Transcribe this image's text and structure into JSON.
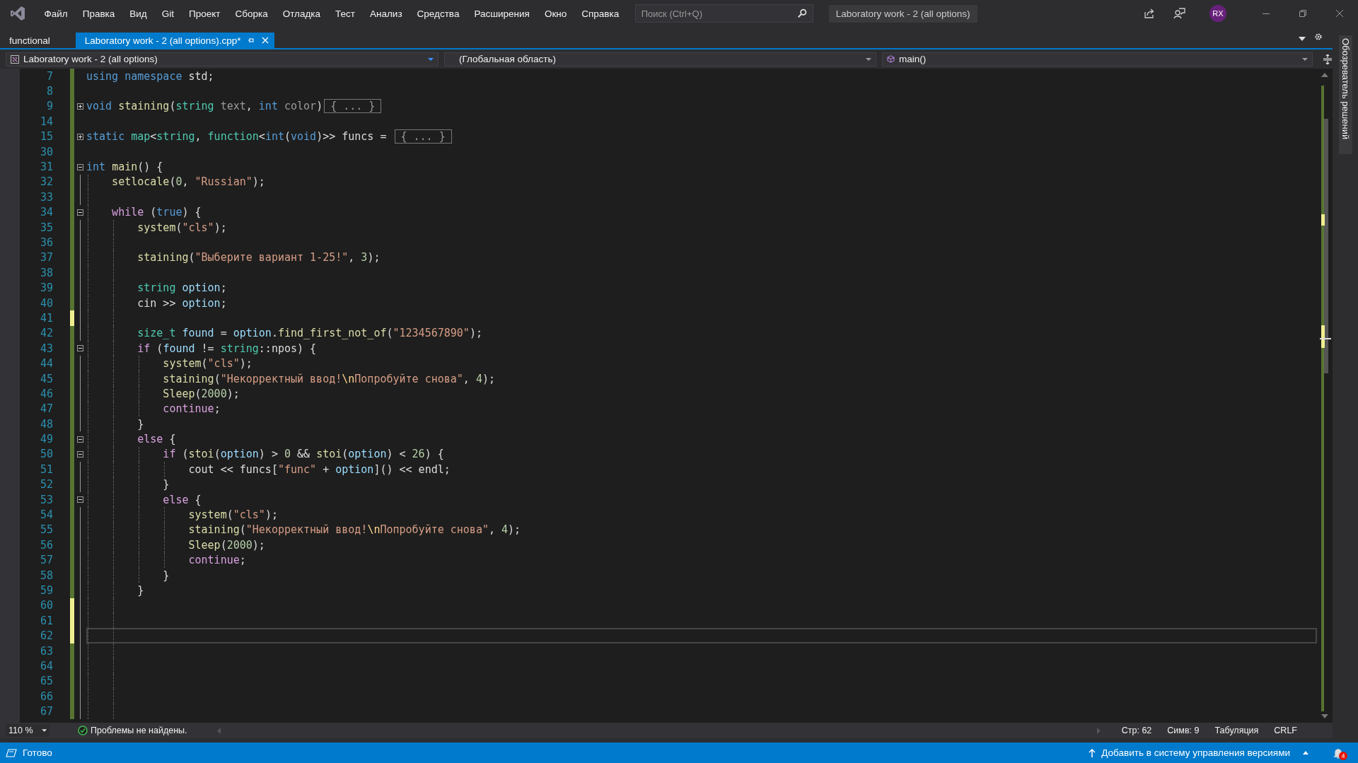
{
  "menu_bar": {
    "items": [
      "Файл",
      "Правка",
      "Вид",
      "Git",
      "Проект",
      "Сборка",
      "Отладка",
      "Тест",
      "Анализ",
      "Средства",
      "Расширения",
      "Окно",
      "Справка"
    ],
    "search": {
      "placeholder": "Поиск (Ctrl+Q)"
    },
    "window_title": "Laboratory work - 2 (all options)",
    "avatar": "RX"
  },
  "tabs": [
    {
      "label": "functional",
      "selected": false
    },
    {
      "label": "Laboratory work - 2 (all options).cpp*",
      "selected": true
    }
  ],
  "navigation_bar": {
    "project": "Laboratory work - 2 (all options)",
    "scope": "(Глобальная область)",
    "member": "main()"
  },
  "editor": {
    "lines": [
      {
        "number": "7",
        "unsaved": false,
        "current": false,
        "tokens": [
          {
            "kind": "keyword",
            "text": "using "
          },
          {
            "kind": "keyword",
            "text": "namespace "
          },
          {
            "kind": "plain",
            "text": "std;"
          }
        ]
      },
      {
        "number": "8",
        "unsaved": false,
        "current": false
      },
      {
        "number": "9",
        "unsaved": false,
        "current": false,
        "collapsed": true,
        "tokens": [
          {
            "kind": "keyword",
            "text": "void "
          },
          {
            "kind": "function",
            "text": "staining"
          },
          {
            "kind": "plain",
            "text": "("
          },
          {
            "kind": "type",
            "text": "string "
          },
          {
            "kind": "parameter",
            "text": "text"
          },
          {
            "kind": "plain",
            "text": ", "
          },
          {
            "kind": "keyword",
            "text": "int "
          },
          {
            "kind": "parameter",
            "text": "color"
          },
          {
            "kind": "plain",
            "text": ")"
          },
          {
            "kind": "collapsed",
            "text": "{ ... }"
          }
        ]
      },
      {
        "number": "14",
        "unsaved": false,
        "current": false
      },
      {
        "number": "15",
        "unsaved": false,
        "current": false,
        "collapsed": true,
        "tokens": [
          {
            "kind": "keyword",
            "text": "static "
          },
          {
            "kind": "type",
            "text": "map"
          },
          {
            "kind": "plain",
            "text": "<"
          },
          {
            "kind": "type",
            "text": "string"
          },
          {
            "kind": "plain",
            "text": ", "
          },
          {
            "kind": "type",
            "text": "function"
          },
          {
            "kind": "plain",
            "text": "<"
          },
          {
            "kind": "keyword",
            "text": "int"
          },
          {
            "kind": "plain",
            "text": "("
          },
          {
            "kind": "keyword",
            "text": "void"
          },
          {
            "kind": "plain",
            "text": ")>> funcs = "
          },
          {
            "kind": "collapsed",
            "text": "{ ... }"
          }
        ]
      },
      {
        "number": "30",
        "unsaved": false,
        "current": false
      },
      {
        "number": "31",
        "unsaved": false,
        "current": false,
        "collapsed": false,
        "tokens": [
          {
            "kind": "keyword",
            "text": "int "
          },
          {
            "kind": "function",
            "text": "main"
          },
          {
            "kind": "plain",
            "text": "() {"
          }
        ]
      },
      {
        "number": "32",
        "unsaved": false,
        "current": false,
        "tokens": [
          {
            "kind": "function",
            "text": "    setlocale"
          },
          {
            "kind": "plain",
            "text": "("
          },
          {
            "kind": "number",
            "text": "0"
          },
          {
            "kind": "plain",
            "text": ", "
          },
          {
            "kind": "string",
            "text": "\"Russian\""
          },
          {
            "kind": "plain",
            "text": ");"
          }
        ]
      },
      {
        "number": "33",
        "unsaved": false,
        "current": false
      },
      {
        "number": "34",
        "unsaved": false,
        "current": false,
        "collapsed": false,
        "tokens": [
          {
            "kind": "control",
            "text": "    while "
          },
          {
            "kind": "plain",
            "text": "("
          },
          {
            "kind": "keyword",
            "text": "true"
          },
          {
            "kind": "plain",
            "text": ") {"
          }
        ]
      },
      {
        "number": "35",
        "unsaved": false,
        "current": false,
        "tokens": [
          {
            "kind": "function",
            "text": "        system"
          },
          {
            "kind": "plain",
            "text": "("
          },
          {
            "kind": "string",
            "text": "\"cls\""
          },
          {
            "kind": "plain",
            "text": ");"
          }
        ]
      },
      {
        "number": "36",
        "unsaved": false,
        "current": false
      },
      {
        "number": "37",
        "unsaved": false,
        "current": false,
        "tokens": [
          {
            "kind": "function",
            "text": "        staining"
          },
          {
            "kind": "plain",
            "text": "("
          },
          {
            "kind": "string",
            "text": "\"Выберите вариант 1-25!\""
          },
          {
            "kind": "plain",
            "text": ", "
          },
          {
            "kind": "number",
            "text": "3"
          },
          {
            "kind": "plain",
            "text": ");"
          }
        ]
      },
      {
        "number": "38",
        "unsaved": false,
        "current": false
      },
      {
        "number": "39",
        "unsaved": false,
        "current": false,
        "tokens": [
          {
            "kind": "type",
            "text": "        string "
          },
          {
            "kind": "variable",
            "text": "option"
          },
          {
            "kind": "plain",
            "text": ";"
          }
        ]
      },
      {
        "number": "40",
        "unsaved": false,
        "current": false,
        "tokens": [
          {
            "kind": "plain",
            "text": "        cin >> "
          },
          {
            "kind": "variable",
            "text": "option"
          },
          {
            "kind": "plain",
            "text": ";"
          }
        ]
      },
      {
        "number": "41",
        "unsaved": true,
        "current": false
      },
      {
        "number": "42",
        "unsaved": false,
        "current": false,
        "tokens": [
          {
            "kind": "type",
            "text": "        size_t "
          },
          {
            "kind": "variable",
            "text": "found"
          },
          {
            "kind": "plain",
            "text": " = "
          },
          {
            "kind": "variable",
            "text": "option"
          },
          {
            "kind": "plain",
            "text": "."
          },
          {
            "kind": "function",
            "text": "find_first_not_of"
          },
          {
            "kind": "plain",
            "text": "("
          },
          {
            "kind": "string",
            "text": "\"1234567890\""
          },
          {
            "kind": "plain",
            "text": ");"
          }
        ]
      },
      {
        "number": "43",
        "unsaved": false,
        "current": false,
        "collapsed": false,
        "tokens": [
          {
            "kind": "control",
            "text": "        if "
          },
          {
            "kind": "plain",
            "text": "("
          },
          {
            "kind": "variable",
            "text": "found"
          },
          {
            "kind": "plain",
            "text": " != "
          },
          {
            "kind": "type",
            "text": "string"
          },
          {
            "kind": "plain",
            "text": "::npos) {"
          }
        ]
      },
      {
        "number": "44",
        "unsaved": false,
        "current": false,
        "tokens": [
          {
            "kind": "function",
            "text": "            system"
          },
          {
            "kind": "plain",
            "text": "("
          },
          {
            "kind": "string",
            "text": "\"cls\""
          },
          {
            "kind": "plain",
            "text": ");"
          }
        ]
      },
      {
        "number": "45",
        "unsaved": false,
        "current": false,
        "tokens": [
          {
            "kind": "function",
            "text": "            staining"
          },
          {
            "kind": "plain",
            "text": "("
          },
          {
            "kind": "string",
            "text": "\"Некорректный ввод!"
          },
          {
            "kind": "escape",
            "text": "\\n"
          },
          {
            "kind": "string",
            "text": "Попробуйте снова\""
          },
          {
            "kind": "plain",
            "text": ", "
          },
          {
            "kind": "number",
            "text": "4"
          },
          {
            "kind": "plain",
            "text": ");"
          }
        ]
      },
      {
        "number": "46",
        "unsaved": false,
        "current": false,
        "tokens": [
          {
            "kind": "function",
            "text": "            Sleep"
          },
          {
            "kind": "plain",
            "text": "("
          },
          {
            "kind": "number",
            "text": "2000"
          },
          {
            "kind": "plain",
            "text": ");"
          }
        ]
      },
      {
        "number": "47",
        "unsaved": false,
        "current": false,
        "tokens": [
          {
            "kind": "control",
            "text": "            continue"
          },
          {
            "kind": "plain",
            "text": ";"
          }
        ]
      },
      {
        "number": "48",
        "unsaved": false,
        "current": false,
        "tokens": [
          {
            "kind": "plain",
            "text": "        }"
          }
        ]
      },
      {
        "number": "49",
        "unsaved": false,
        "current": false,
        "collapsed": false,
        "tokens": [
          {
            "kind": "control",
            "text": "        else "
          },
          {
            "kind": "plain",
            "text": "{"
          }
        ]
      },
      {
        "number": "50",
        "unsaved": false,
        "current": false,
        "collapsed": false,
        "tokens": [
          {
            "kind": "control",
            "text": "            if "
          },
          {
            "kind": "plain",
            "text": "("
          },
          {
            "kind": "function",
            "text": "stoi"
          },
          {
            "kind": "plain",
            "text": "("
          },
          {
            "kind": "variable",
            "text": "option"
          },
          {
            "kind": "plain",
            "text": ") > "
          },
          {
            "kind": "number",
            "text": "0"
          },
          {
            "kind": "plain",
            "text": " && "
          },
          {
            "kind": "function",
            "text": "stoi"
          },
          {
            "kind": "plain",
            "text": "("
          },
          {
            "kind": "variable",
            "text": "option"
          },
          {
            "kind": "plain",
            "text": ") < "
          },
          {
            "kind": "number",
            "text": "26"
          },
          {
            "kind": "plain",
            "text": ") {"
          }
        ]
      },
      {
        "number": "51",
        "unsaved": false,
        "current": false,
        "tokens": [
          {
            "kind": "plain",
            "text": "                cout << funcs["
          },
          {
            "kind": "string",
            "text": "\"func\""
          },
          {
            "kind": "plain",
            "text": " + "
          },
          {
            "kind": "variable",
            "text": "option"
          },
          {
            "kind": "plain",
            "text": "]() << endl;"
          }
        ]
      },
      {
        "number": "52",
        "unsaved": false,
        "current": false,
        "tokens": [
          {
            "kind": "plain",
            "text": "            }"
          }
        ]
      },
      {
        "number": "53",
        "unsaved": false,
        "current": false,
        "collapsed": false,
        "tokens": [
          {
            "kind": "control",
            "text": "            else "
          },
          {
            "kind": "plain",
            "text": "{"
          }
        ]
      },
      {
        "number": "54",
        "unsaved": false,
        "current": false,
        "tokens": [
          {
            "kind": "function",
            "text": "                system"
          },
          {
            "kind": "plain",
            "text": "("
          },
          {
            "kind": "string",
            "text": "\"cls\""
          },
          {
            "kind": "plain",
            "text": ");"
          }
        ]
      },
      {
        "number": "55",
        "unsaved": false,
        "current": false,
        "tokens": [
          {
            "kind": "function",
            "text": "                staining"
          },
          {
            "kind": "plain",
            "text": "("
          },
          {
            "kind": "string",
            "text": "\"Некорректный ввод!"
          },
          {
            "kind": "escape",
            "text": "\\n"
          },
          {
            "kind": "string",
            "text": "Попробуйте снова\""
          },
          {
            "kind": "plain",
            "text": ", "
          },
          {
            "kind": "number",
            "text": "4"
          },
          {
            "kind": "plain",
            "text": ");"
          }
        ]
      },
      {
        "number": "56",
        "unsaved": false,
        "current": false,
        "tokens": [
          {
            "kind": "function",
            "text": "                Sleep"
          },
          {
            "kind": "plain",
            "text": "("
          },
          {
            "kind": "number",
            "text": "2000"
          },
          {
            "kind": "plain",
            "text": ");"
          }
        ]
      },
      {
        "number": "57",
        "unsaved": false,
        "current": false,
        "tokens": [
          {
            "kind": "control",
            "text": "                continue"
          },
          {
            "kind": "plain",
            "text": ";"
          }
        ]
      },
      {
        "number": "58",
        "unsaved": false,
        "current": false,
        "tokens": [
          {
            "kind": "plain",
            "text": "            }"
          }
        ]
      },
      {
        "number": "59",
        "unsaved": false,
        "current": false,
        "tokens": [
          {
            "kind": "plain",
            "text": "        }"
          }
        ]
      },
      {
        "number": "60",
        "unsaved": true,
        "current": false
      },
      {
        "number": "61",
        "unsaved": true,
        "current": false
      },
      {
        "number": "62",
        "unsaved": true,
        "current": true
      },
      {
        "number": "63",
        "unsaved": false,
        "current": false
      },
      {
        "number": "64",
        "unsaved": false,
        "current": false
      },
      {
        "number": "65",
        "unsaved": false,
        "current": false
      },
      {
        "number": "66",
        "unsaved": false,
        "current": false
      },
      {
        "number": "67",
        "unsaved": false,
        "current": false
      }
    ]
  },
  "editor_status": {
    "zoom": "110 %",
    "problems": "Проблемы не найдены.",
    "line": "Стр: 62",
    "column": "Симв: 9",
    "indent_mode": "Табуляция",
    "line_endings": "CRLF"
  },
  "side_panel_tab": "Обозреватель решений",
  "status_bar": {
    "state": "Готово",
    "source_control": "Добавить в систему управления версиями",
    "notifications": "4"
  }
}
